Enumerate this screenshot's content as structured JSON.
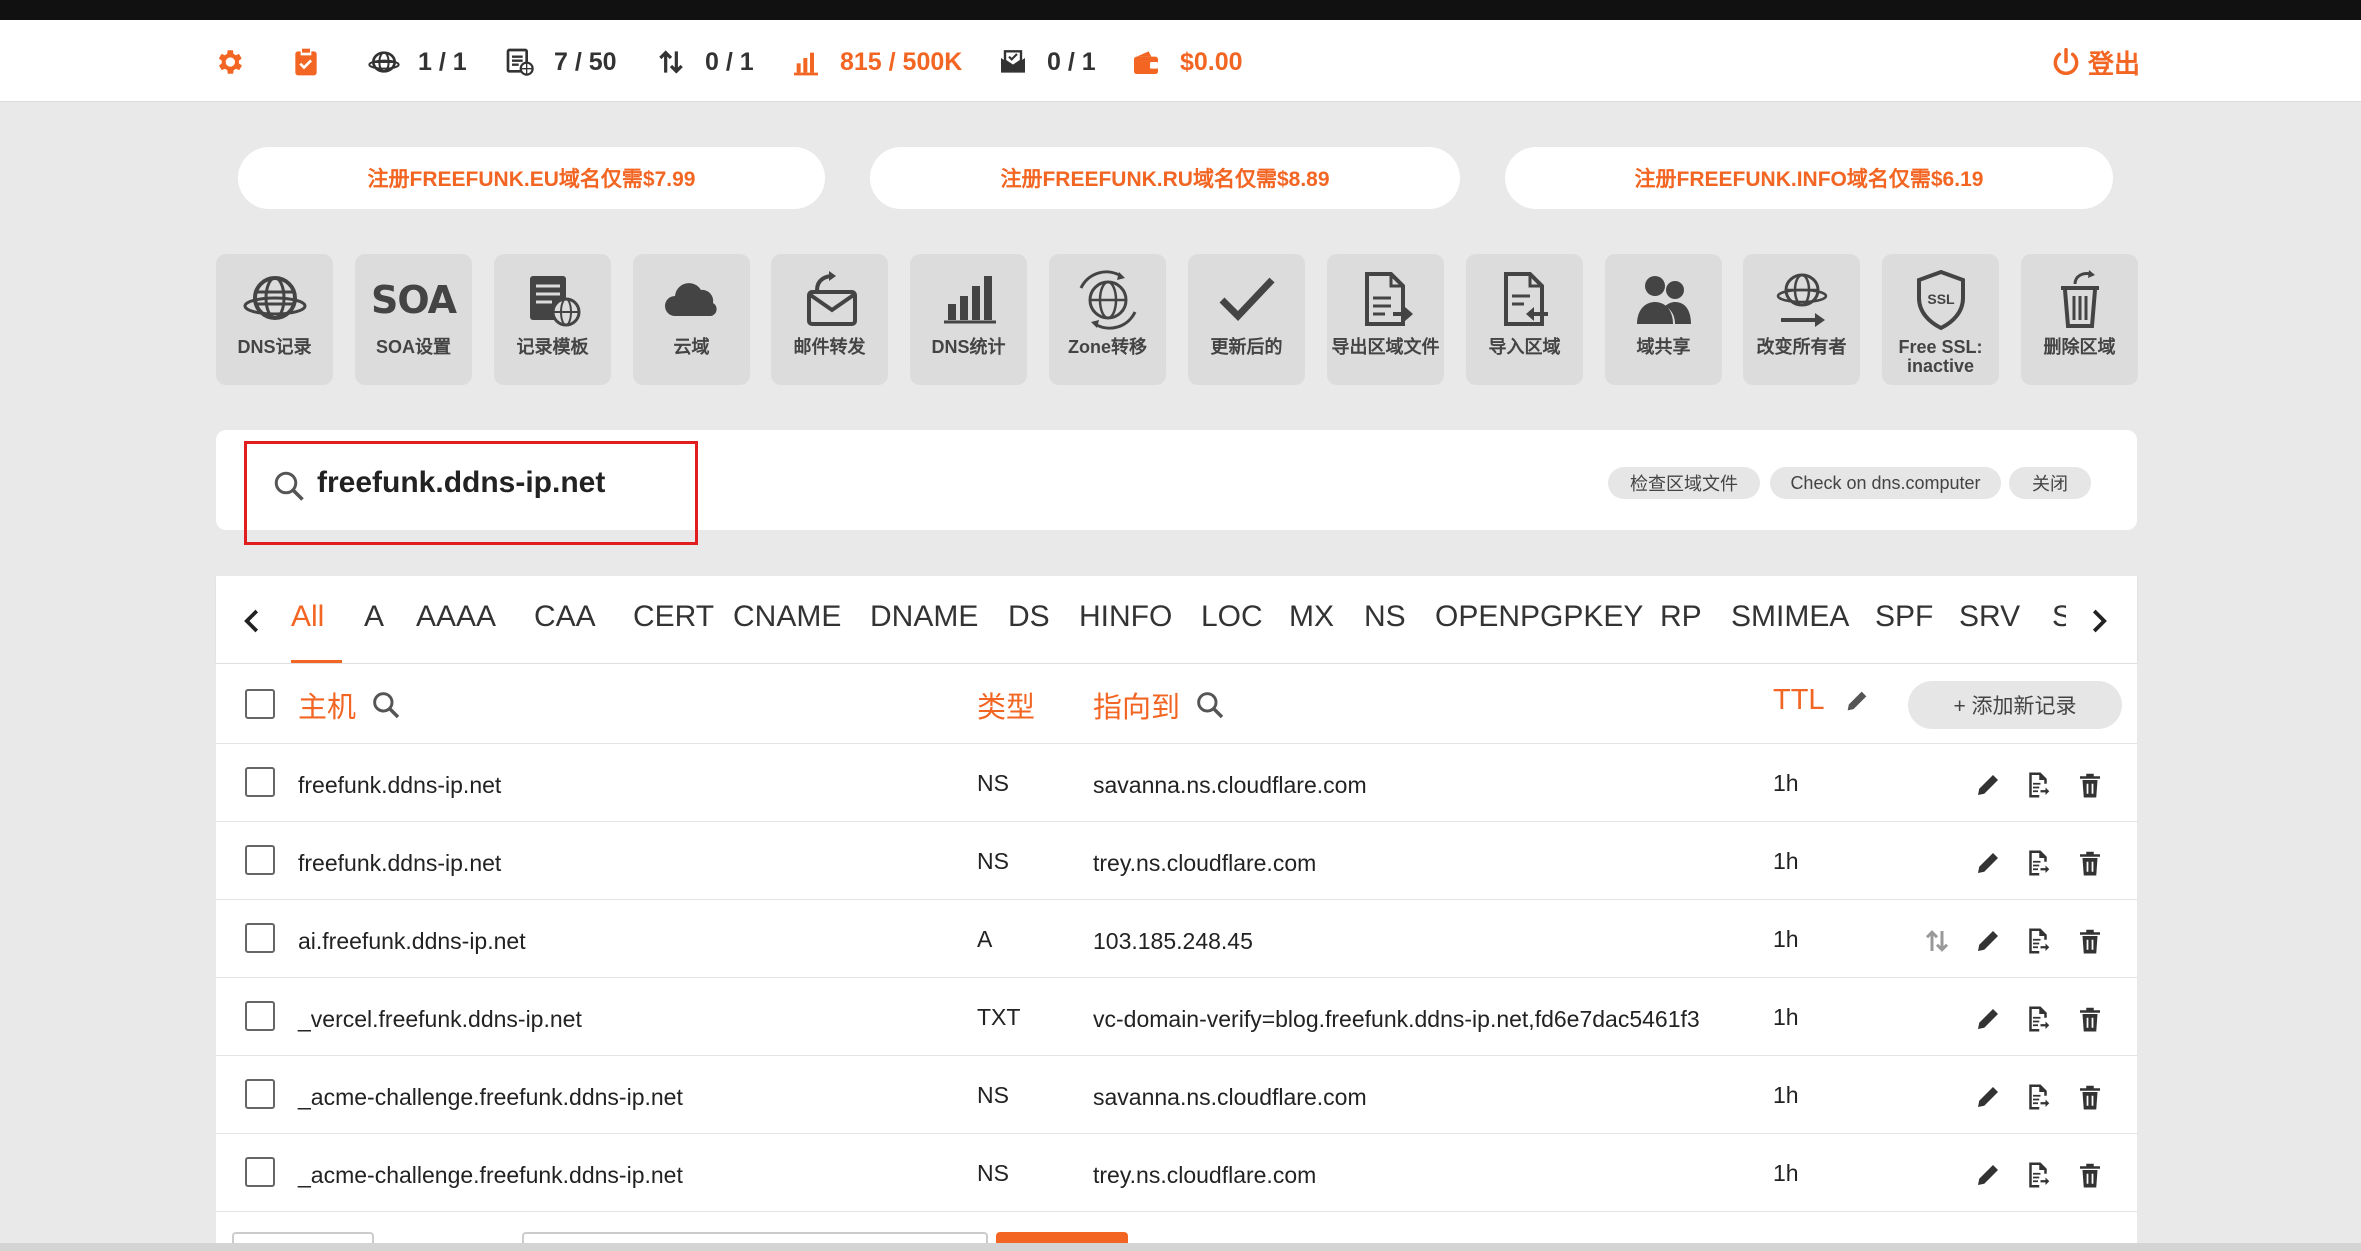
{
  "stats": {
    "globe": "1 / 1",
    "records": "7 / 50",
    "transfers": "0 / 1",
    "queries": "815 / 500K",
    "mail": "0 / 1",
    "balance": "$0.00"
  },
  "logout_label": "登出",
  "promos": [
    "注册FREEFUNK.EU域名仅需$7.99",
    "注册FREEFUNK.RU域名仅需$8.89",
    "注册FREEFUNK.INFO域名仅需$6.19"
  ],
  "tools": [
    {
      "label": "DNS记录",
      "icon": "globe-icon"
    },
    {
      "label": "SOA设置",
      "icon": "soa-text-icon",
      "icon_text": "SOA"
    },
    {
      "label": "记录模板",
      "icon": "template-icon"
    },
    {
      "label": "云域",
      "icon": "cloud-icon"
    },
    {
      "label": "邮件转发",
      "icon": "mail-forward-icon"
    },
    {
      "label": "DNS统计",
      "icon": "bar-chart-icon"
    },
    {
      "label": "Zone转移",
      "icon": "zone-transfer-icon"
    },
    {
      "label": "更新后的",
      "icon": "checkmark-icon"
    },
    {
      "label": "导出区域文件",
      "icon": "export-file-icon"
    },
    {
      "label": "导入区域",
      "icon": "import-file-icon"
    },
    {
      "label": "域共享",
      "icon": "users-icon"
    },
    {
      "label": "改变所有者",
      "icon": "change-owner-icon"
    },
    {
      "label": "Free SSL: inactive",
      "icon": "ssl-shield-icon",
      "icon_text": "SSL"
    },
    {
      "label": "删除区域",
      "icon": "trash-delete-icon"
    }
  ],
  "domain": "freefunk.ddns-ip.net",
  "zone_actions": {
    "check_zone": "检查区域文件",
    "check_dns_computer": "Check on dns.computer",
    "close": "关闭"
  },
  "record_types": [
    "All",
    "A",
    "AAAA",
    "CAA",
    "CERT",
    "CNAME",
    "DNAME",
    "DS",
    "HINFO",
    "LOC",
    "MX",
    "NS",
    "OPENPGPKEY",
    "RP",
    "SMIMEA",
    "SPF",
    "SRV",
    "S"
  ],
  "active_type": "All",
  "table": {
    "headers": {
      "host": "主机",
      "type": "类型",
      "points_to": "指向到",
      "ttl": "TTL"
    },
    "add_button": "+ 添加新记录",
    "rows": [
      {
        "host": "freefunk.ddns-ip.net",
        "type": "NS",
        "value": "savanna.ns.cloudflare.com",
        "ttl": "1h"
      },
      {
        "host": "freefunk.ddns-ip.net",
        "type": "NS",
        "value": "trey.ns.cloudflare.com",
        "ttl": "1h"
      },
      {
        "host": "ai.freefunk.ddns-ip.net",
        "type": "A",
        "value": "103.185.248.45",
        "ttl": "1h"
      },
      {
        "host": "_vercel.freefunk.ddns-ip.net",
        "type": "TXT",
        "value": "vc-domain-verify=blog.freefunk.ddns-ip.net,fd6e7dac5461f3",
        "ttl": "1h"
      },
      {
        "host": "_acme-challenge.freefunk.ddns-ip.net",
        "type": "NS",
        "value": "savanna.ns.cloudflare.com",
        "ttl": "1h"
      },
      {
        "host": "_acme-challenge.freefunk.ddns-ip.net",
        "type": "NS",
        "value": "trey.ns.cloudflare.com",
        "ttl": "1h"
      }
    ]
  },
  "colors": {
    "accent": "#f26522",
    "highlight_border": "#e01e1e",
    "panel": "#ffffff",
    "background": "#e9e9e9"
  }
}
